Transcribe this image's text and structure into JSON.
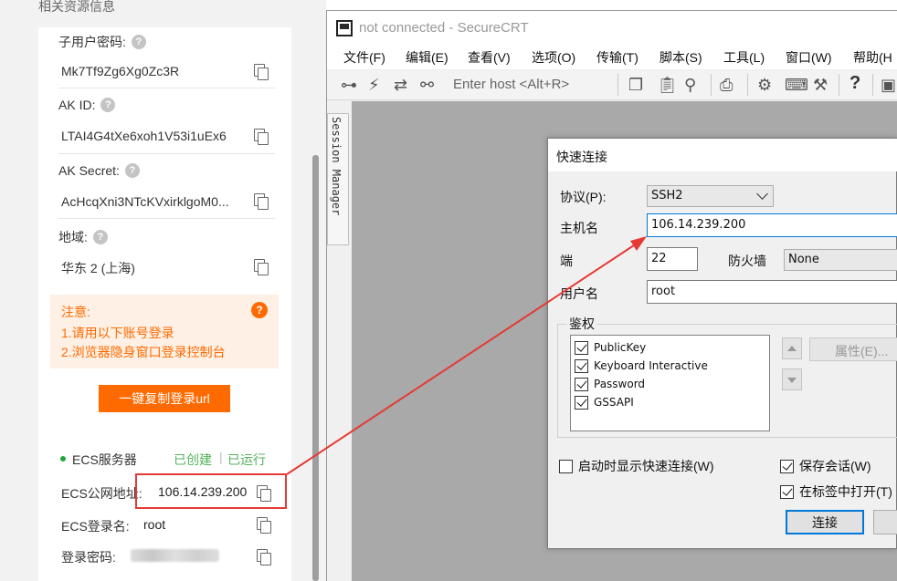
{
  "left_panel": {
    "section_title": "相关资源信息",
    "fields": [
      {
        "label": "子用户密码:",
        "value": "Mk7Tf9Zg6Xg0Zc3R"
      },
      {
        "label": "AK ID:",
        "value": "LTAI4G4tXe6xoh1V53i1uEx6"
      },
      {
        "label": "AK Secret:",
        "value": "AcHcqXni3NTcKVxirklgoM0..."
      },
      {
        "label": "地域:",
        "value": "华东 2 (上海)"
      }
    ],
    "help_icon": "question-circle-icon",
    "copy_icon": "copy-icon",
    "notice": {
      "title": "注意:",
      "line1": "1.请用以下账号登录",
      "line2": "2.浏览器隐身窗口登录控制台"
    },
    "copy_login_button": "一键复制登录url",
    "ecs": {
      "title": "ECS服务器",
      "created": "已创建",
      "separator": "|",
      "running": "已运行",
      "public_ip_label": "ECS公网地址:",
      "public_ip": "106.14.239.200",
      "login_name_label": "ECS登录名:",
      "login_name": "root",
      "password_label": "登录密码:"
    },
    "colors": {
      "accent": "#ff6a00",
      "status_green": "#22a53b",
      "highlight": "#e53935"
    }
  },
  "securecrt": {
    "title": "not connected - SecureCRT",
    "menu": [
      "文件(F)",
      "编辑(E)",
      "查看(V)",
      "选项(O)",
      "传输(T)",
      "脚本(S)",
      "工具(L)",
      "窗口(W)",
      "帮助(H"
    ],
    "toolbar_icons": [
      "connect-tree-icon",
      "lightning-icon",
      "reconnect-icon",
      "link-icon",
      "copy-icon",
      "paste-icon",
      "find-icon",
      "print-icon",
      "settings-gear-icon",
      "keymap-icon",
      "tool-icon",
      "help-icon",
      "session-icon"
    ],
    "enter_host_placeholder": "Enter host <Alt+R>",
    "session_manager": "Session Manager"
  },
  "quick_connect": {
    "title": "快速连接",
    "protocol_label": "协议(P):",
    "protocol_value": "SSH2",
    "host_label": "主机名",
    "host_value": "106.14.239.200",
    "port_label": "端",
    "port_value": "22",
    "firewall_label": "防火墙",
    "firewall_value": "None",
    "username_label": "用户名",
    "username_value": "root",
    "auth_legend": "鉴权",
    "auth_methods": [
      {
        "name": "PublicKey",
        "checked": true
      },
      {
        "name": "Keyboard Interactive",
        "checked": true
      },
      {
        "name": "Password",
        "checked": true
      },
      {
        "name": "GSSAPI",
        "checked": true
      }
    ],
    "properties_button": "属性(E)...",
    "show_on_startup": {
      "label": "启动时显示快速连接(W)",
      "checked": false
    },
    "save_session": {
      "label": "保存会话(W)",
      "checked": true
    },
    "open_in_tab": {
      "label": "在标签中打开(T)",
      "checked": true
    },
    "connect_button": "连接"
  }
}
